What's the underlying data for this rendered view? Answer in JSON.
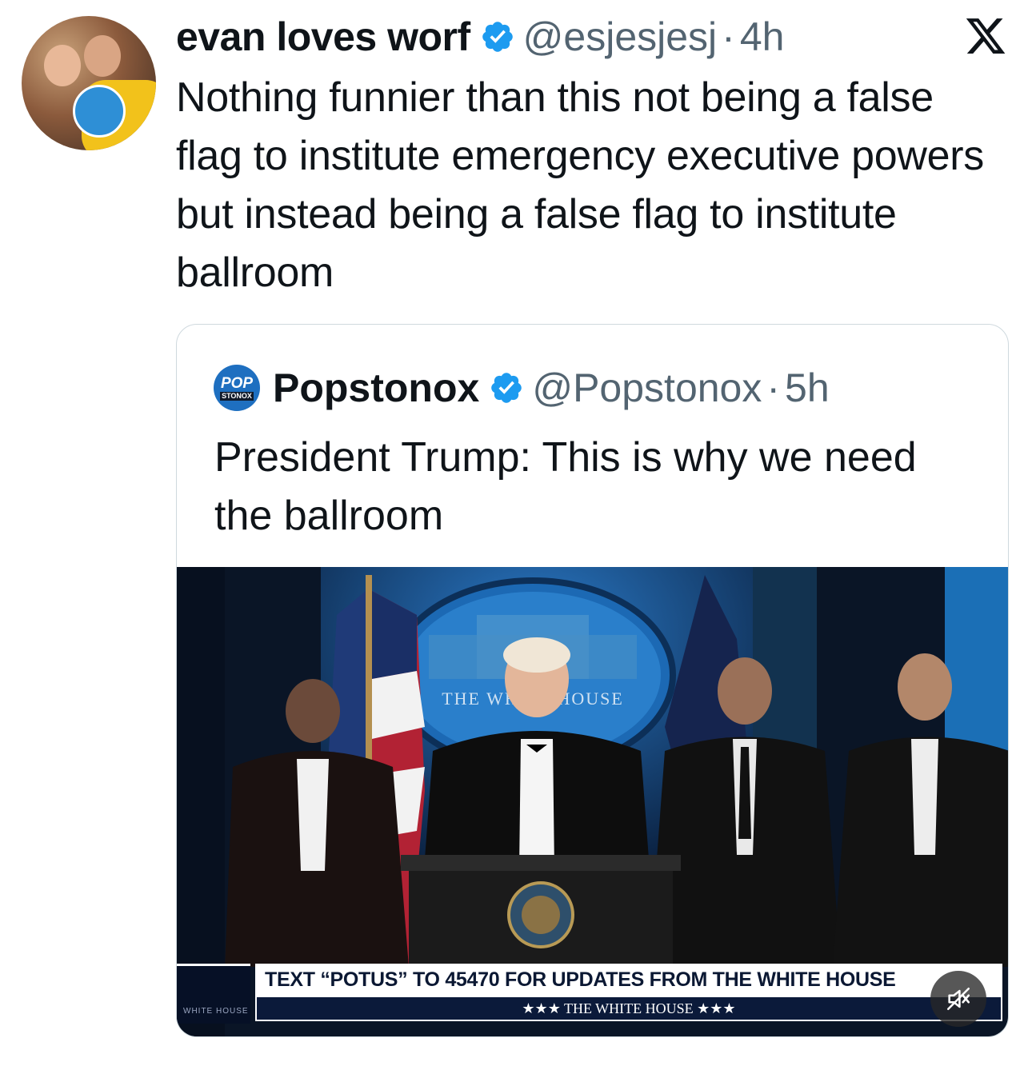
{
  "tweet": {
    "author_name": "evan loves worf",
    "handle": "@esjesjesj",
    "separator": "·",
    "time": "4h",
    "text": "Nothing funnier than this not being a false flag to institute emergency executive powers but instead being a false flag to institute ballroom",
    "verified": true
  },
  "quote": {
    "author_name": "Popstonox",
    "avatar_text_top": "POP",
    "avatar_text_bottom": "STONOX",
    "handle": "@Popstonox",
    "separator": "·",
    "time": "5h",
    "text": "President Trump: This is why we need the ballroom",
    "verified": true,
    "media": {
      "seal_text": "THE WHITE HOUSE",
      "ticker_text": "TEXT “POTUS” TO 45470 FOR UPDATES FROM THE WHITE HOUSE",
      "ticker_sub": "★★★  THE WHITE HOUSE  ★★★",
      "corner_mark": "WHITE HOUSE"
    }
  },
  "icons": {
    "platform": "x-logo-icon",
    "verified": "verified-badge-icon",
    "mute": "muted-speaker-icon"
  },
  "colors": {
    "verified_blue": "#1d9bf0",
    "secondary_text": "#536471",
    "quote_border": "#cfd9de"
  }
}
